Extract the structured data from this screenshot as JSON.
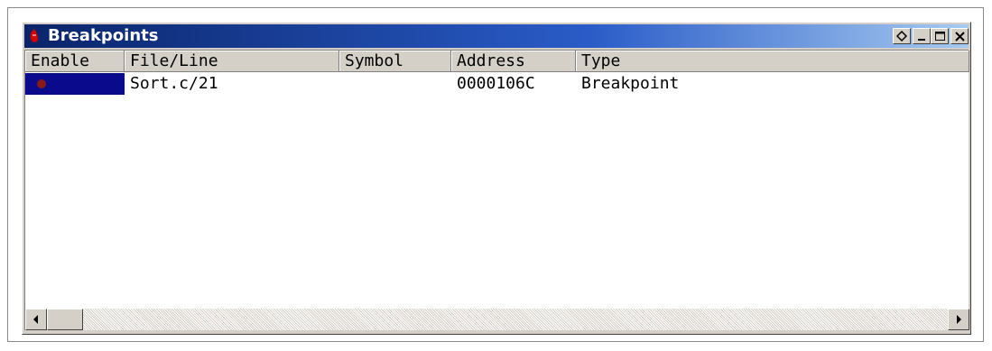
{
  "window": {
    "title": "Breakpoints",
    "controls": [
      "restore-diamond",
      "minimize",
      "maximize",
      "close"
    ]
  },
  "columns": [
    "Enable",
    "File/Line",
    "Symbol",
    "Address",
    "Type"
  ],
  "rows": [
    {
      "enabled": true,
      "file_line": "Sort.c/21",
      "symbol": "",
      "address": "0000106C",
      "type": "Breakpoint"
    }
  ],
  "colors": {
    "title_bar_start": "#0a246a",
    "title_bar_end": "#a6caf0",
    "selection": "#0a0a8c",
    "breakpoint_dot": "#8a1a1a"
  }
}
